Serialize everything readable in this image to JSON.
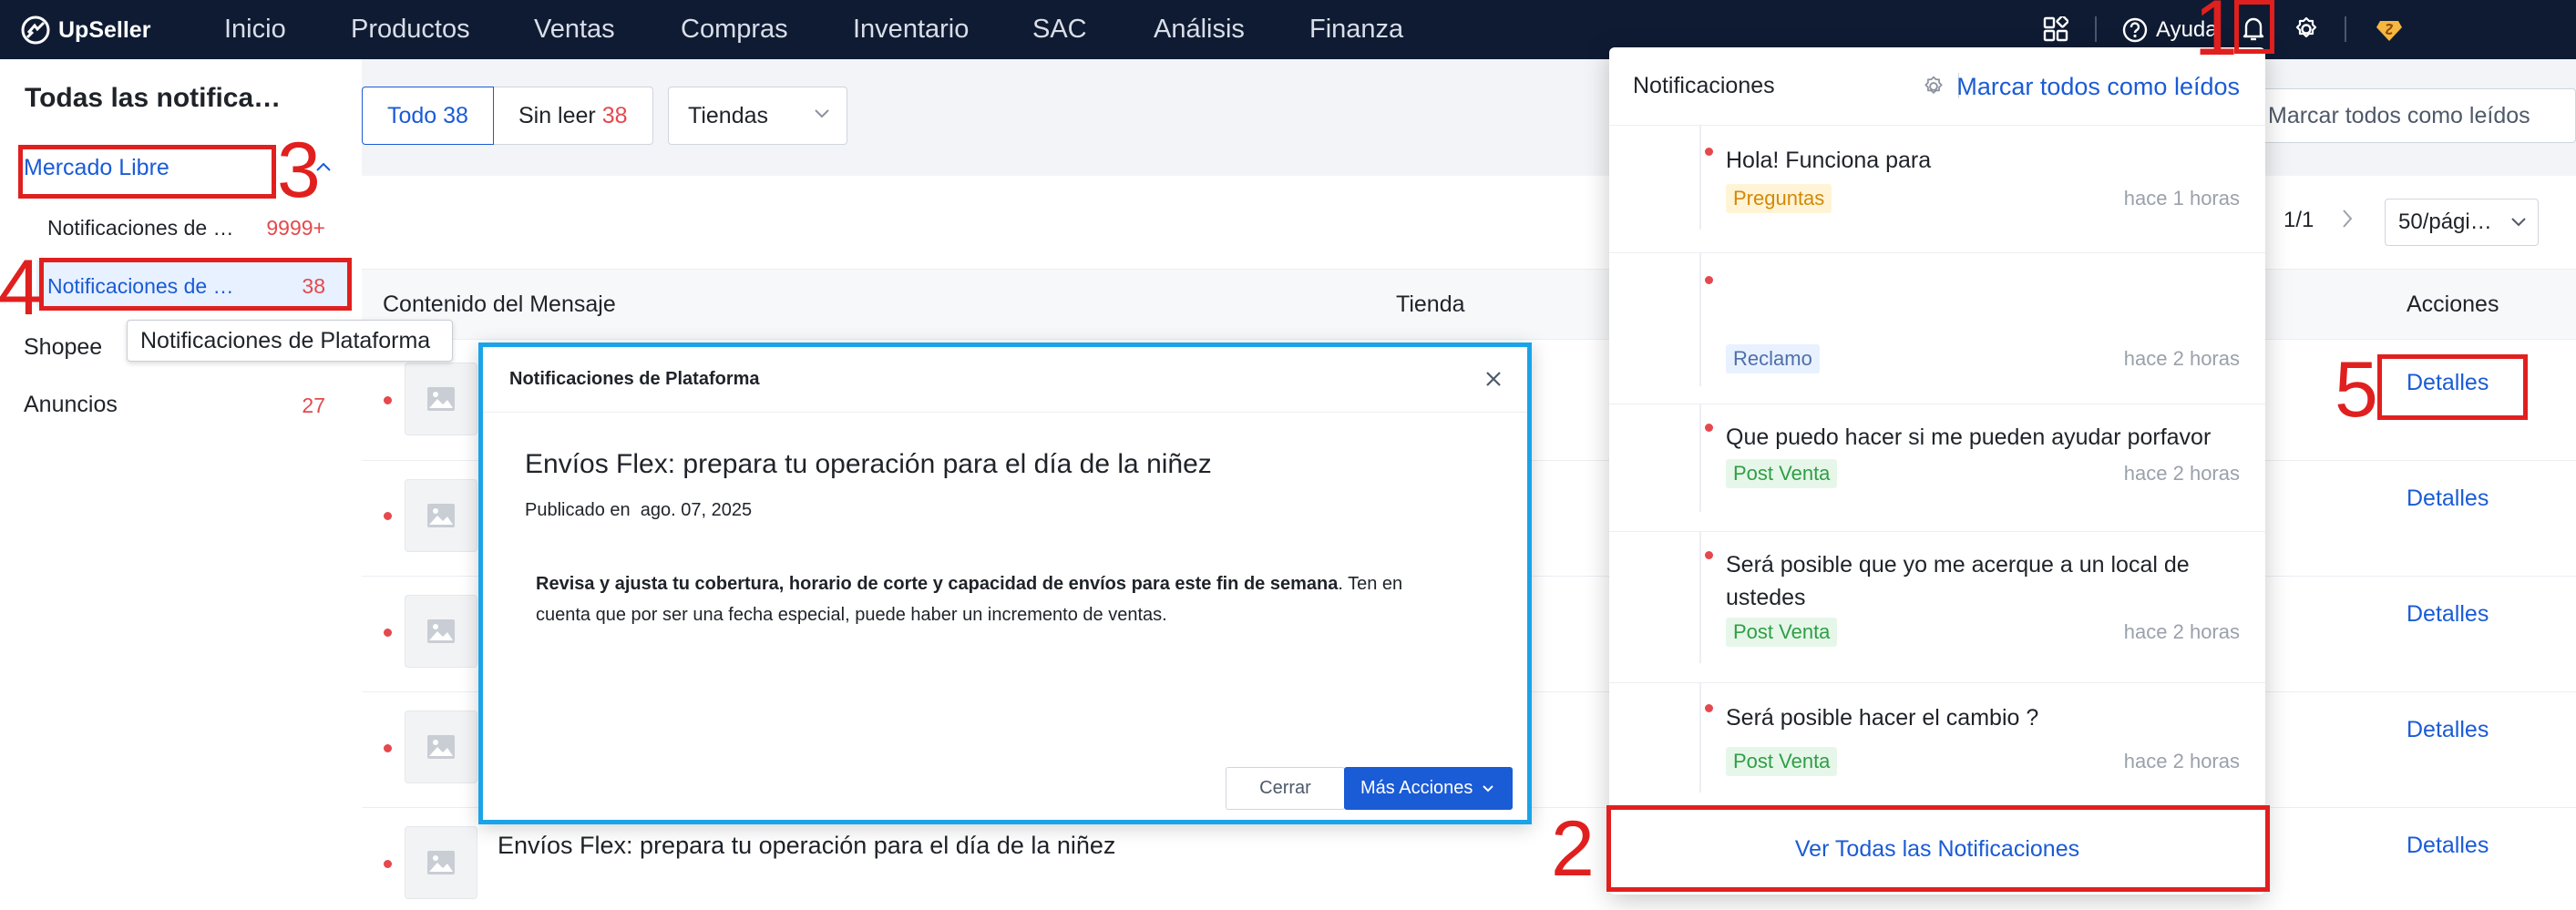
{
  "topnav": {
    "brand": "UpSeller",
    "items": [
      "Inicio",
      "Productos",
      "Ventas",
      "Compras",
      "Inventario",
      "SAC",
      "Análisis",
      "Finanza"
    ],
    "help_label": "Ayuda"
  },
  "sidebar": {
    "title": "Todas las notifica…",
    "groups": [
      {
        "label": "Mercado Libre",
        "subitems": [
          {
            "label": "Notificaciones de …",
            "count": "9999+"
          },
          {
            "label": "Notificaciones de …",
            "count": "38"
          }
        ]
      },
      {
        "label": "Shopee"
      },
      {
        "label": "Anuncios",
        "count": "27"
      }
    ],
    "tooltip": "Notificaciones de Plataforma"
  },
  "filters": {
    "tab_all": "Todo 38",
    "tab_unread_label": "Sin leer",
    "tab_unread_count": "38",
    "store_select": "Tiendas",
    "mark_all_read": "Marcar todos como leídos"
  },
  "pagination": {
    "page": "1/1",
    "page_size": "50/pági…"
  },
  "table": {
    "headers": [
      "Contenido del Mensaje",
      "Tienda",
      "Acciones"
    ],
    "rows": [
      {
        "content": "",
        "action": "Detalles"
      },
      {
        "content": "",
        "action": "Detalles"
      },
      {
        "content": "",
        "action": "Detalles"
      },
      {
        "content": "",
        "action": "Detalles"
      },
      {
        "content": "Envíos Flex: prepara tu operación para el día de la niñez",
        "action": "Detalles"
      }
    ]
  },
  "modal": {
    "title": "Notificaciones de Plataforma",
    "heading": "Envíos Flex: prepara tu operación para el día de la niñez",
    "published_label": "Publicado en",
    "published_date": "ago. 07, 2025",
    "body_bold": "Revisa y ajusta tu cobertura, horario de corte y capacidad de envíos para este fin de semana",
    "body_rest": ". Ten en cuenta que por ser una fecha especial, puede haber un incremento de ventas.",
    "cancel_label": "Cerrar",
    "more_label": "Más Acciones"
  },
  "notifications": {
    "title": "Notificaciones",
    "mark_all": "Marcar todos como leídos",
    "items": [
      {
        "text": "Hola! Funciona para",
        "tag": "Preguntas",
        "time": "hace 1 horas"
      },
      {
        "text": "",
        "tag": "Reclamo",
        "time": "hace 2 horas"
      },
      {
        "text": "Que puedo hacer si me pueden ayudar porfavor",
        "tag": "Post Venta",
        "time": "hace 2 horas"
      },
      {
        "text": "Será posible que yo me acerque a un local de ustedes",
        "tag": "Post Venta",
        "time": "hace 2 horas"
      },
      {
        "text": "Será posible hacer el cambio ?",
        "tag": "Post Venta",
        "time": "hace 2 horas"
      }
    ],
    "view_all": "Ver Todas las Notificaciones"
  },
  "annotations": [
    "1",
    "2",
    "3",
    "4",
    "5"
  ],
  "colors": {
    "accent": "#1a5bd6",
    "unread": "#e5484d",
    "annotation": "#e0201f",
    "modal_border": "#1aa3e8",
    "nav_bg": "#0f1b33"
  }
}
